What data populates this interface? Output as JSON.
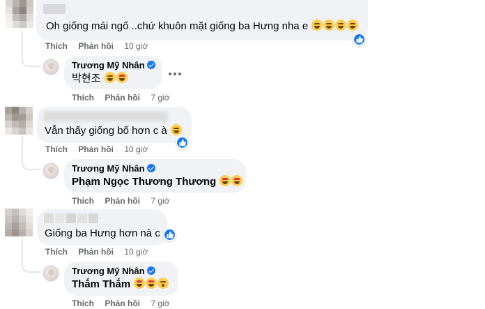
{
  "comments": [
    {
      "text": "Oh giống mái ngố ..chứ khuôn mặt giống ba Hưng nha e",
      "emojis": [
        "joy",
        "joy",
        "joy",
        "joy"
      ],
      "reaction_icon": "like-icon",
      "like_label": "Thích",
      "reply_label": "Phản hồi",
      "time": "10 giờ",
      "reply": {
        "author": "Trương Mỹ Nhân",
        "text": "박현조",
        "emojis": [
          "rofl",
          "heart-eyes"
        ],
        "like_label": "Thích",
        "reply_label": "Phản hồi",
        "time": "7 giờ"
      }
    },
    {
      "text": "Vẫn thấy giống bố hơn c à",
      "emojis": [
        "joy"
      ],
      "reaction_icon": "like-icon",
      "like_label": "Thích",
      "reply_label": "Phản hồi",
      "time": "10 giờ",
      "reply": {
        "author": "Trương Mỹ Nhân",
        "text": "Phạm Ngọc Thương Thương",
        "emojis": [
          "heart-eyes",
          "heart-eyes"
        ],
        "like_label": "Thích",
        "reply_label": "Phản hồi",
        "time": "7 giờ"
      }
    },
    {
      "text": "Giống ba Hưng hơn nà c",
      "emojis": [],
      "reaction_icon": "like-icon",
      "like_label": "Thích",
      "reply_label": "Phản hồi",
      "time": "10 giờ",
      "reply": {
        "author": "Trương Mỹ Nhân",
        "text": "Thắm Thắm",
        "emojis": [
          "heart-eyes",
          "heart-eyes",
          "kiss"
        ],
        "like_label": "Thích",
        "reply_label": "Phản hồi",
        "time": "7 giờ"
      }
    }
  ],
  "colors": {
    "bubble": "#f0f2f5",
    "meta_text": "#65676b",
    "like_blue": "#1877f2",
    "thread_line": "#e4e6eb"
  }
}
